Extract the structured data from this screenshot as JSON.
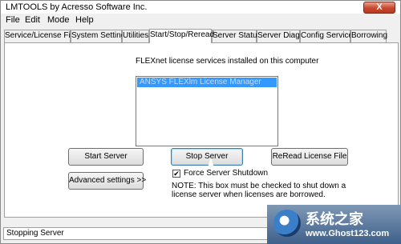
{
  "window": {
    "title": "LMTOOLS by Acresso Software Inc.",
    "close_label": "X"
  },
  "menu": [
    "File",
    "Edit",
    "Mode",
    "Help"
  ],
  "tabs": [
    "Service/License File",
    "System Settings",
    "Utilities",
    "Start/Stop/Reread",
    "Server Status",
    "Server Diags",
    "Config Services",
    "Borrowing"
  ],
  "active_tab": "Start/Stop/Reread",
  "panel": {
    "installed_label": "FLEXnet license services installed on this computer",
    "selected_service": "ANSYS FLEXlm License Manager",
    "start_button": "Start Server",
    "stop_button": "Stop Server",
    "reread_button": "ReRead License File",
    "advanced_button": "Advanced settings >>",
    "force_shutdown_label": "Force Server Shutdown",
    "force_shutdown_checked": true,
    "checkmark": "✔",
    "note": "NOTE:  This box must be checked to shut down a license server when licenses are borrowed."
  },
  "status": {
    "text": "Stopping Server"
  },
  "watermark": {
    "title": "系统之家",
    "url": "www.Ghost123.com"
  }
}
